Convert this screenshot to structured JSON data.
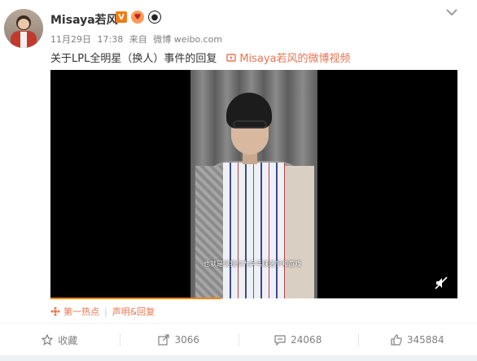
{
  "post": {
    "username": "Misaya若风",
    "verified_badge": "V",
    "emoji_1": "heart-face-icon",
    "emoji_2": "panda-icon",
    "meta": {
      "date": "11月29日",
      "time": "17:38",
      "source_prefix": "来自",
      "source": "微博 weibo.com"
    },
    "text": "关于LPL全明星（换人）事件的回复",
    "video_link": "Misaya若风的微博视频",
    "video": {
      "subtitle": "也就是说我作为乒乓球选手和游戏",
      "progress": 0.42
    },
    "tags": {
      "hot": "第一热点",
      "statement": "声明&回复"
    },
    "actions": {
      "favorite": "收藏",
      "repost": "3066",
      "comment": "24068",
      "like": "345884"
    }
  },
  "colors": {
    "accent": "#eb7350",
    "verified": "#f07b14",
    "progress": "#ff8200"
  }
}
